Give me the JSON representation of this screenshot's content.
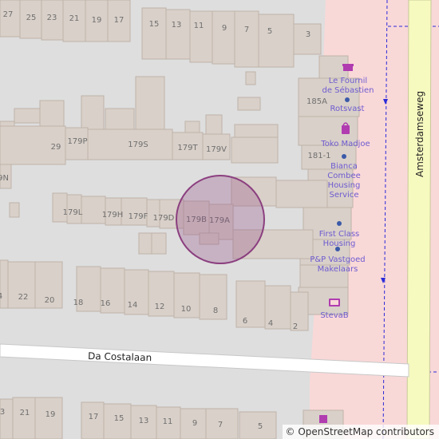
{
  "map": {
    "colors": {
      "background": "#dedede",
      "building": "#d9d0c9",
      "building_outline": "#bfb3a9",
      "main_road": "#f7fabf",
      "pedestrian_area": "#f9d8d8",
      "minor_road": "#ffffff",
      "poi": "#6d5bd0",
      "marker": "#8b3f7f"
    },
    "streets": {
      "da_costalaan": "Da Costalaan",
      "amsterdamseweg": "Amsterdamseweg"
    },
    "house_numbers": {
      "n27": "27",
      "n25": "25",
      "n23": "23",
      "n21": "21",
      "n19": "19",
      "n17": "17",
      "n15": "15",
      "n13": "13",
      "n11": "11",
      "n9": "9",
      "n7": "7",
      "n5": "5",
      "n3": "3",
      "n185a": "185A",
      "n181_1": "181-1",
      "n29": "29",
      "n179p": "179P",
      "n179s": "179S",
      "n179t": "179T",
      "n179v": "179V",
      "n9n": "9N",
      "n179l": "179L",
      "n179h": "179H",
      "n179f": "179F",
      "n179d": "179D",
      "n179b": "179B",
      "n179a": "179A",
      "b4": "4",
      "b22": "22",
      "b20": "20",
      "b18": "18",
      "b16": "16",
      "b14": "14",
      "b12": "12",
      "b10": "10",
      "b8": "8",
      "b6": "6",
      "b4b": "4",
      "b2": "2",
      "c3": "3",
      "c21": "21",
      "c19": "19",
      "c17": "17",
      "c15": "15",
      "c13": "13",
      "c11": "11",
      "c9": "9",
      "c7": "7",
      "c5": "5"
    },
    "pois": {
      "fournil_line1": "Le Fournil",
      "fournil_line2": "de Sébastien",
      "rotsvast": "Rotsvast",
      "toko": "Toko Madjoe",
      "bianca_line1": "Bianca",
      "bianca_line2": "Combee",
      "bianca_line3": "Housing",
      "bianca_line4": "Service",
      "firstclass_line1": "First Class",
      "firstclass_line2": "Housing",
      "pp_line1": "P&P Vastgoed",
      "pp_line2": "Makelaars",
      "steva": "StevaB"
    },
    "attribution": "© OpenStreetMap contributors"
  }
}
